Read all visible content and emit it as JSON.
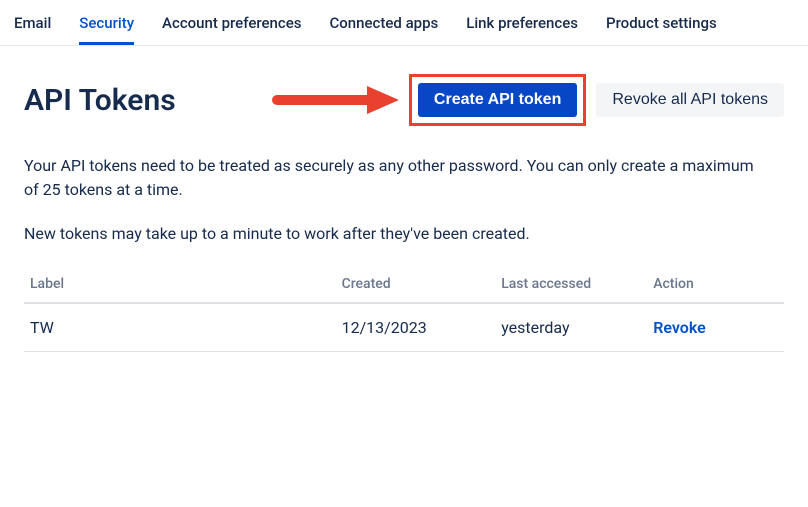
{
  "tabs": {
    "email": "Email",
    "security": "Security",
    "account_preferences": "Account preferences",
    "connected_apps": "Connected apps",
    "link_preferences": "Link preferences",
    "product_settings": "Product settings"
  },
  "page": {
    "title": "API Tokens",
    "create_button": "Create API token",
    "revoke_all_button": "Revoke all API tokens",
    "desc1": "Your API tokens need to be treated as securely as any other password. You can only create a maximum of 25 tokens at a time.",
    "desc2": "New tokens may take up to a minute to work after they've been created."
  },
  "table": {
    "headers": {
      "label": "Label",
      "created": "Created",
      "last_accessed": "Last accessed",
      "action": "Action"
    },
    "rows": [
      {
        "label": "TW",
        "created": "12/13/2023",
        "last_accessed": "yesterday",
        "action": "Revoke"
      }
    ]
  }
}
